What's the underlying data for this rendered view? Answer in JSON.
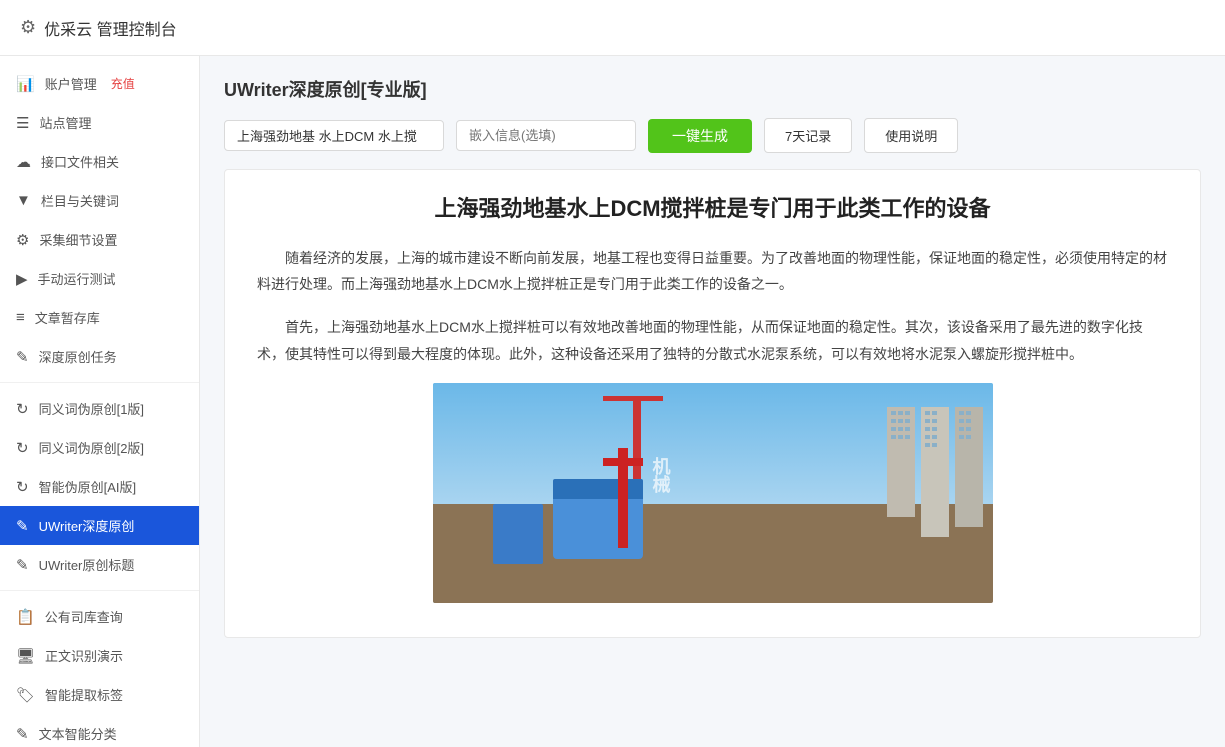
{
  "header": {
    "title": "优采云 管理控制台",
    "gear_icon": "⚙"
  },
  "sidebar": {
    "items": [
      {
        "id": "account",
        "icon": "📊",
        "label": "账户管理",
        "badge": "充值",
        "active": false
      },
      {
        "id": "site",
        "icon": "☰",
        "label": "站点管理",
        "active": false
      },
      {
        "id": "interface",
        "icon": "☁",
        "label": "接口文件相关",
        "active": false
      },
      {
        "id": "columns",
        "icon": "▼",
        "label": "栏目与关键词",
        "active": false
      },
      {
        "id": "collection",
        "icon": "⚙",
        "label": "采集细节设置",
        "active": false
      },
      {
        "id": "manual",
        "icon": "▶",
        "label": "手动运行测试",
        "active": false
      },
      {
        "id": "draft",
        "icon": "≡",
        "label": "文章暂存库",
        "active": false
      },
      {
        "id": "deeporiginal",
        "icon": "✎",
        "label": "深度原创任务",
        "active": false
      },
      {
        "id": "synonym1",
        "icon": "↻",
        "label": "同义词伪原创[1版]",
        "active": false
      },
      {
        "id": "synonym2",
        "icon": "↻",
        "label": "同义词伪原创[2版]",
        "active": false
      },
      {
        "id": "aifake",
        "icon": "↻",
        "label": "智能伪原创[AI版]",
        "active": false
      },
      {
        "id": "uwriterdeep",
        "icon": "✎",
        "label": "UWriter深度原创",
        "active": true
      },
      {
        "id": "uwritertitle",
        "icon": "✎",
        "label": "UWriter原创标题",
        "active": false
      },
      {
        "id": "company",
        "icon": "📋",
        "label": "公有司库查询",
        "active": false
      },
      {
        "id": "recognition",
        "icon": "🖥",
        "label": "正文识别演示",
        "active": false
      },
      {
        "id": "smarttag",
        "icon": "🏷",
        "label": "智能提取标签",
        "active": false
      },
      {
        "id": "textclass",
        "icon": "✎",
        "label": "文本智能分类",
        "active": false
      }
    ]
  },
  "main": {
    "page_title": "UWriter深度原创[专业版]",
    "toolbar": {
      "keyword_value": "上海强劲地基 水上DCM 水上搅",
      "embed_placeholder": "嵌入信息(选填)",
      "btn_generate": "一键生成",
      "btn_history": "7天记录",
      "btn_help": "使用说明"
    },
    "article": {
      "title": "上海强劲地基水上DCM搅拌桩是专门用于此类工作的设备",
      "paragraphs": [
        "随着经济的发展，上海的城市建设不断向前发展，地基工程也变得日益重要。为了改善地面的物理性能，保证地面的稳定性，必须使用特定的材料进行处理。而上海强劲地基水上DCM水上搅拌桩正是专门用于此类工作的设备之一。",
        "首先，上海强劲地基水上DCM水上搅拌桩可以有效地改善地面的物理性能，从而保证地面的稳定性。其次，该设备采用了最先进的数字化技术，使其特性可以得到最大程度的体现。此外，这种设备还采用了独特的分散式水泥泵系统，可以有效地将水泥泵入螺旋形搅拌桩中。"
      ]
    }
  }
}
